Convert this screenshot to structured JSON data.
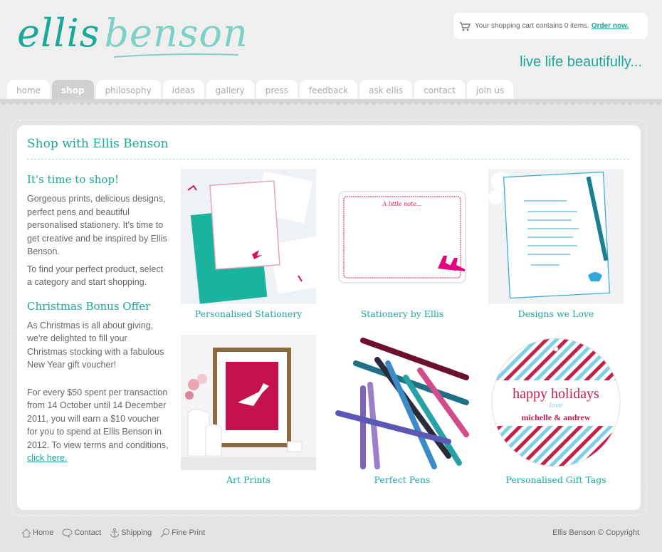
{
  "brand": {
    "logo_part1": "ellis",
    "logo_part2": "benson",
    "tagline": "live life beautifully..."
  },
  "cart": {
    "text": "Your shopping cart contains 0 items.",
    "link": "Order now."
  },
  "nav": [
    "home",
    "shop",
    "philosophy",
    "ideas",
    "gallery",
    "press",
    "feedback",
    "ask ellis",
    "contact",
    "join us"
  ],
  "page": {
    "title": "Shop with Ellis Benson"
  },
  "intro": {
    "heading": "It's time to shop!",
    "p1": "Gorgeous prints, delicious designs, perfect pens and beautiful personalised stationery. It's time to get creative and be inspired by Ellis Benson.",
    "p2": "To find your perfect product, select a category and start shopping."
  },
  "offer": {
    "heading": "Christmas Bonus Offer",
    "p1": "As Christmas is all about giving, we're delighted to fill your Christmas stocking with a fabulous New Year gift voucher!",
    "p2": "For every $50 spent per transaction from 14 October until 14 December 2011, you will earn a $10 voucher for you to spend at Ellis Benson in 2012. To view terms and conditions,",
    "link": "click here."
  },
  "categories": [
    {
      "label": "Personalised Stationery"
    },
    {
      "label": "Stationery by Ellis",
      "card_text": "A little note..."
    },
    {
      "label": "Designs we Love"
    },
    {
      "label": "Art Prints"
    },
    {
      "label": "Perfect Pens"
    },
    {
      "label": "Personalised Gift Tags",
      "tag_line1": "happy holidays",
      "tag_line2": "love",
      "tag_line3": "michelle & andrew"
    }
  ],
  "footer": {
    "home": "Home",
    "contact": "Contact",
    "shipping": "Shipping",
    "fine_print": "Fine Print",
    "copyright": "Ellis Benson © Copyright"
  },
  "colors": {
    "brand": "#1aa89a",
    "brand_light": "#7ed1c6",
    "magenta": "#d4145a",
    "page_bg": "#e3e4e6"
  }
}
